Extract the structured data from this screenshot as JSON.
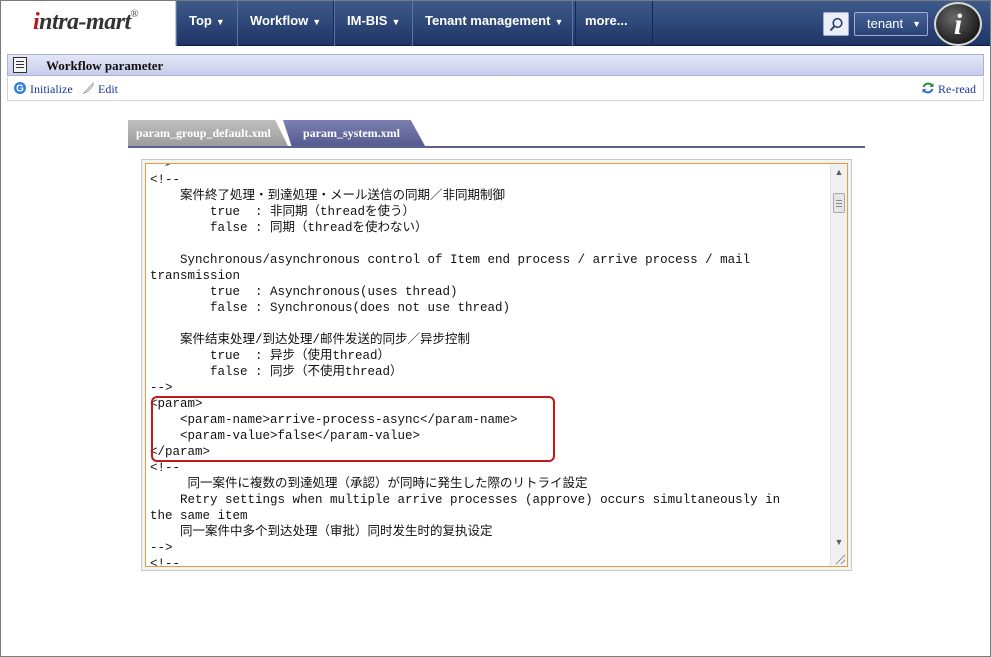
{
  "header": {
    "logo_text": "intra-mart",
    "nav": [
      {
        "label": "Top"
      },
      {
        "label": "Workflow"
      },
      {
        "label": "IM-BIS"
      },
      {
        "label": "Tenant management"
      },
      {
        "label": "more..."
      }
    ],
    "tenant_label": "tenant",
    "avatar_letter": "i"
  },
  "page": {
    "title": "Workflow parameter"
  },
  "toolbar": {
    "initialize_label": "Initialize",
    "edit_label": "Edit",
    "reread_label": "Re-read"
  },
  "tabs": [
    {
      "label": "param_group_default.xml",
      "active": false
    },
    {
      "label": "param_system.xml",
      "active": true
    }
  ],
  "editor": {
    "lines": [
      "-->",
      "<!--",
      "    案件終了処理・到達処理・メール送信の同期／非同期制御",
      "        true  : 非同期（threadを使う）",
      "        false : 同期（threadを使わない）",
      "",
      "    Synchronous/asynchronous control of Item end process / arrive process / mail",
      "transmission",
      "        true  : Asynchronous(uses thread)",
      "        false : Synchronous(does not use thread)",
      "",
      "    案件结束处理/到达处理/邮件发送的同步／异步控制",
      "        true  : 异步（使用thread）",
      "        false : 同步（不使用thread）",
      "-->",
      "<param>",
      "    <param-name>arrive-process-async</param-name>",
      "    <param-value>false</param-value>",
      "</param>",
      "<!--",
      "     同一案件に複数の到達処理（承認）が同時に発生した際のリトライ設定",
      "    Retry settings when multiple arrive processes (approve) occurs simultaneously in",
      "the same item",
      "    同一案件中多个到达处理（审批）同时发生时的复执设定",
      "-->",
      "<!--"
    ]
  }
}
